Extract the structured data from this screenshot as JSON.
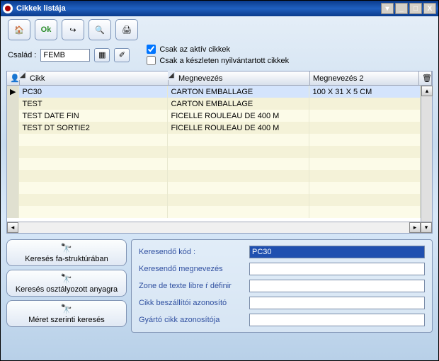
{
  "window": {
    "title": "Cikkek listája"
  },
  "toolbar": {
    "home_icon": "🏠",
    "ok_label": "Ok",
    "exit_icon": "↪",
    "search_icon": "🔍",
    "print_icon": "🖨"
  },
  "filter": {
    "label": "Család :",
    "value": "FEMB",
    "grid_icon": "▦",
    "eraser_icon": "✐",
    "check_active_label": "Csak az aktív cikkek",
    "check_active": true,
    "check_stock_label": "Csak a készleten nyilvántartott cikkek",
    "check_stock": false
  },
  "grid": {
    "headers": {
      "icon": "👤",
      "cikk": "Cikk",
      "megnevezes": "Megnevezés",
      "megnevezes2": "Megnevezés 2",
      "del_icon": "🗑"
    },
    "rows": [
      {
        "ptr": "▶",
        "cikk": "PC30",
        "meg": "CARTON EMBALLAGE",
        "meg2": "100 X 31 X 5 CM",
        "selected": true
      },
      {
        "ptr": "",
        "cikk": "TEST",
        "meg": "CARTON EMBALLAGE",
        "meg2": ""
      },
      {
        "ptr": "",
        "cikk": "TEST DATE FIN",
        "meg": "FICELLE ROULEAU DE 400 M",
        "meg2": ""
      },
      {
        "ptr": "",
        "cikk": "TEST DT SORTIE2",
        "meg": "FICELLE ROULEAU DE 400 M",
        "meg2": ""
      }
    ]
  },
  "buttons": {
    "tree_search": "Keresés fa-struktúrában",
    "class_search": "Keresés osztályozott anyagra",
    "size_search": "Méret szerinti keresés",
    "bino_icon": "🔭"
  },
  "search": {
    "code_label": "Keresendő kód :",
    "code_value": "PC30",
    "name_label": "Keresendő megnevezés",
    "name_value": "",
    "zone_label": "Zone de texte libre ŕ définir",
    "zone_value": "",
    "supplier_label": "Cikk beszállítói azonosító",
    "supplier_value": "",
    "maker_label": "Gyártó cikk azonosítója",
    "maker_value": ""
  }
}
